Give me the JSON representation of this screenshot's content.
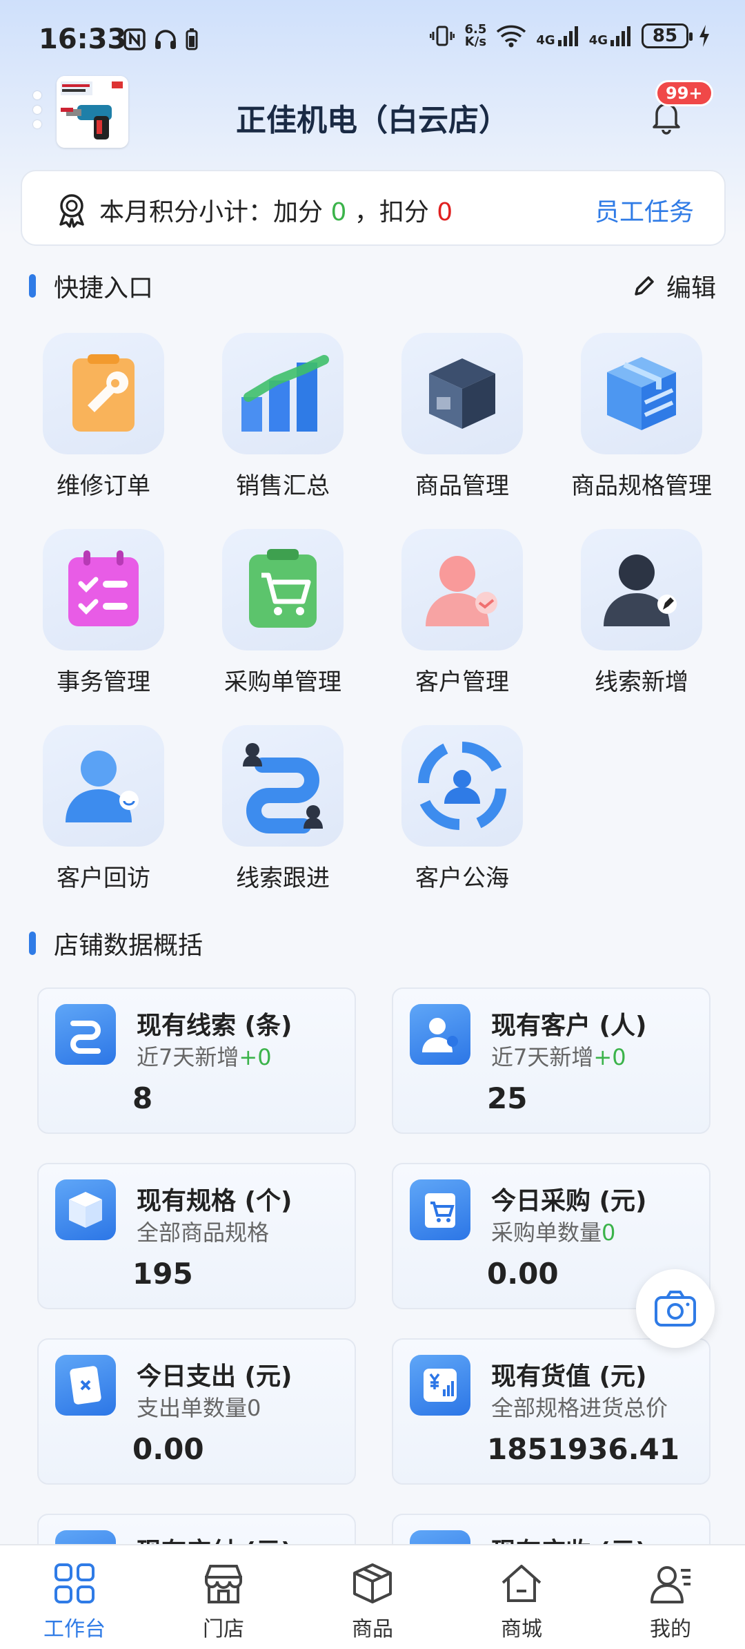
{
  "status_bar": {
    "time": "16:33",
    "net_speed_top": "6.5",
    "net_speed_bottom": "K/s",
    "signal1": "4G",
    "signal2": "4G",
    "battery": "85"
  },
  "header": {
    "title": "正佳机电（白云店）",
    "badge": "99+"
  },
  "points": {
    "prefix": "本月积分小计：加分",
    "add_value": "0",
    "separator": "，扣分",
    "deduct_value": "0",
    "tasks_label": "员工任务"
  },
  "quick_entry": {
    "title": "快捷入口",
    "edit_label": "编辑",
    "items": [
      {
        "label": "维修订单",
        "icon": "wrench-clipboard-icon"
      },
      {
        "label": "销售汇总",
        "icon": "bar-chart-icon"
      },
      {
        "label": "商品管理",
        "icon": "box-icon"
      },
      {
        "label": "商品规格管理",
        "icon": "package-spec-icon"
      },
      {
        "label": "事务管理",
        "icon": "calendar-checklist-icon"
      },
      {
        "label": "采购单管理",
        "icon": "cart-clipboard-icon"
      },
      {
        "label": "客户管理",
        "icon": "customer-handshake-icon"
      },
      {
        "label": "线索新增",
        "icon": "person-pen-icon"
      },
      {
        "label": "客户回访",
        "icon": "person-chat-icon"
      },
      {
        "label": "线索跟进",
        "icon": "path-follow-icon"
      },
      {
        "label": "客户公海",
        "icon": "cycle-people-icon"
      }
    ]
  },
  "store_data": {
    "title": "店铺数据概括",
    "cards": [
      {
        "title": "现有线索 (条)",
        "sub": "近7天新增",
        "sub_extra": "+0",
        "value": "8"
      },
      {
        "title": "现有客户 (人)",
        "sub": "近7天新增",
        "sub_extra": "+0",
        "value": "25"
      },
      {
        "title": "现有规格 (个)",
        "sub": "全部商品规格",
        "sub_extra": "",
        "value": "195"
      },
      {
        "title": "今日采购 (元)",
        "sub": "采购单数量",
        "sub_extra": "0",
        "value": "0.00"
      },
      {
        "title": "今日支出 (元)",
        "sub": "支出单数量0",
        "sub_extra": "",
        "value": "0.00"
      },
      {
        "title": "现有货值 (元)",
        "sub": "全部规格进货总价",
        "sub_extra": "",
        "value": "1851936.41"
      },
      {
        "title": "现有应付 (元)",
        "sub": "",
        "sub_extra": "",
        "value": ""
      },
      {
        "title": "现有应收 (元)",
        "sub": "",
        "sub_extra": "",
        "value": ""
      }
    ]
  },
  "bottom_nav": {
    "items": [
      {
        "label": "工作台",
        "active": true
      },
      {
        "label": "门店",
        "active": false
      },
      {
        "label": "商品",
        "active": false
      },
      {
        "label": "商城",
        "active": false
      },
      {
        "label": "我的",
        "active": false
      }
    ]
  }
}
